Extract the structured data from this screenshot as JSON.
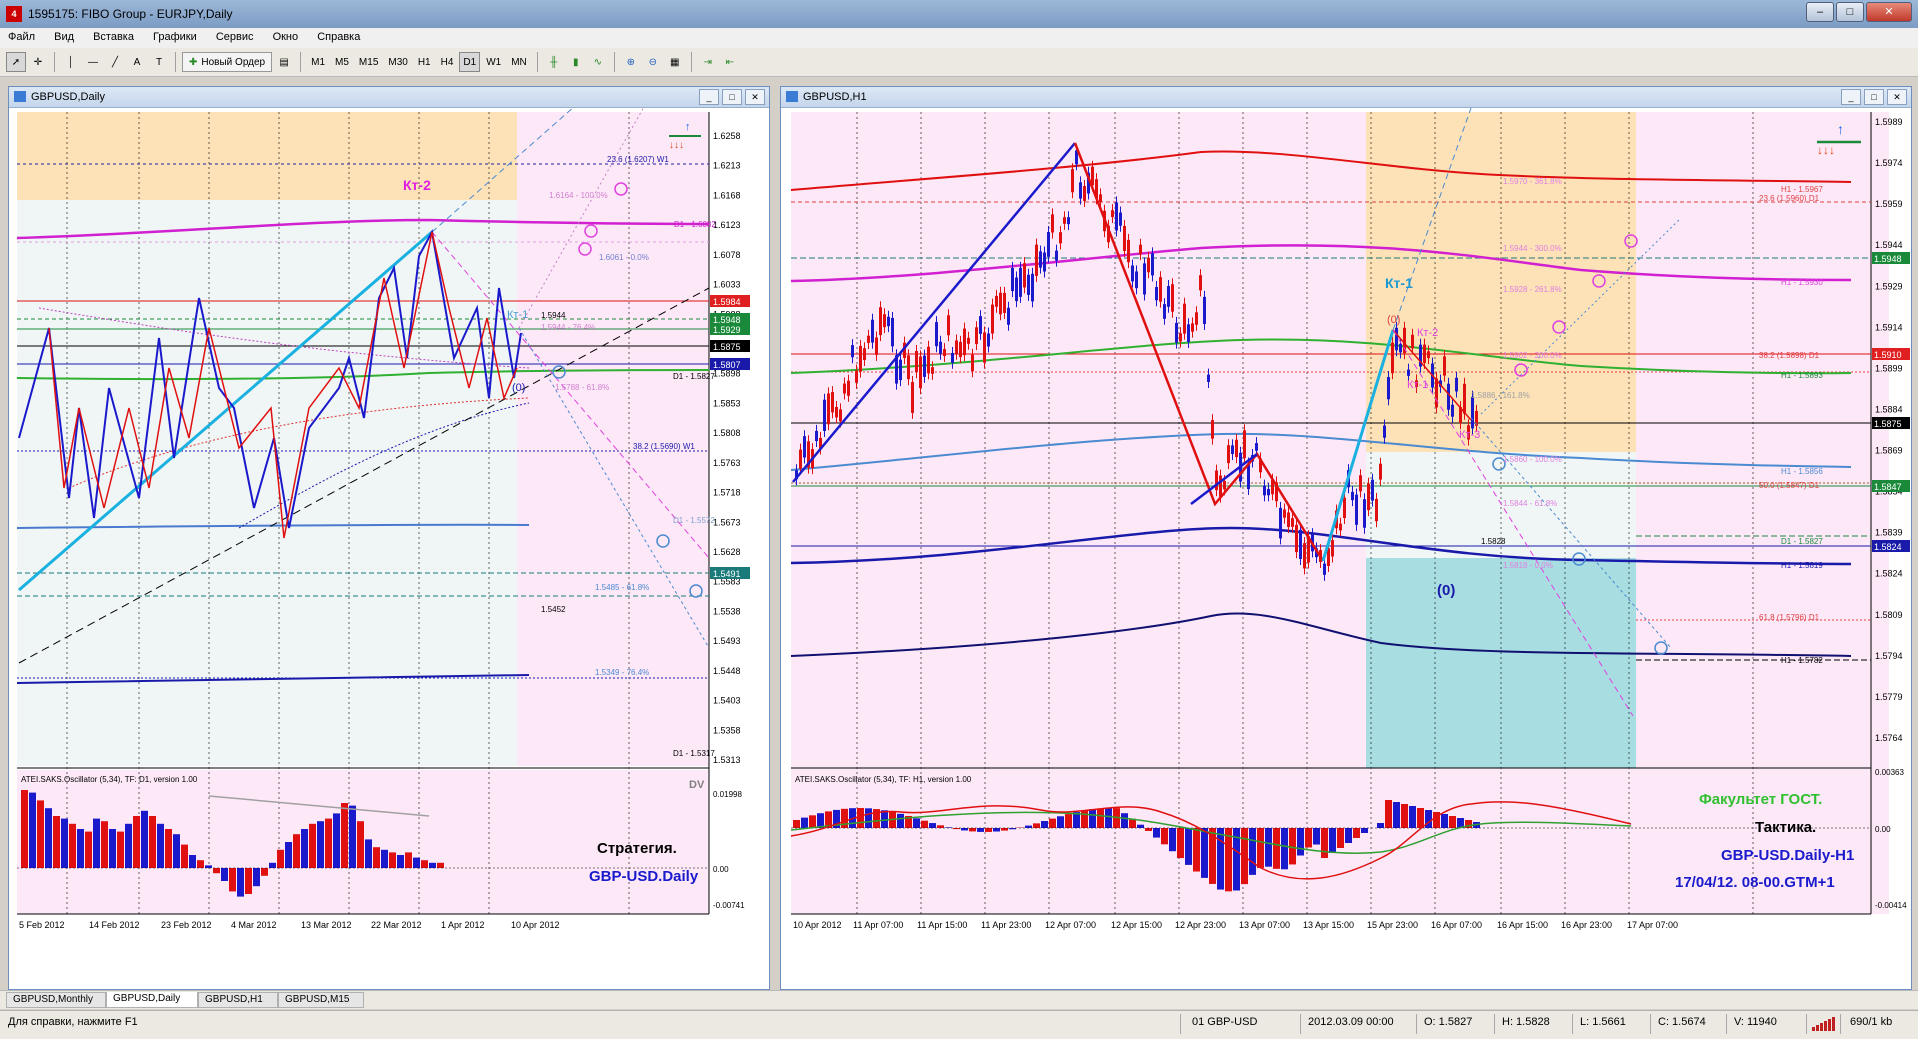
{
  "window": {
    "title": "1595175: FIBO Group - EURJPY,Daily",
    "minimize": "–",
    "maximize": "□",
    "close": "✕",
    "icon": "mt4-app-icon"
  },
  "menu": [
    "Файл",
    "Вид",
    "Вставка",
    "Графики",
    "Сервис",
    "Окно",
    "Справка"
  ],
  "toolbar": {
    "new_order": "Новый Ордер",
    "timeframes": [
      "M1",
      "M5",
      "M15",
      "M30",
      "H1",
      "H4",
      "D1",
      "W1",
      "MN"
    ],
    "active_timeframe": "D1",
    "tools": [
      "cursor-icon",
      "crosshair-icon",
      "vertical-line-icon",
      "horizontal-line-icon",
      "trendline-icon",
      "text-icon",
      "label-icon",
      "zoom-in-icon",
      "zoom-out-icon",
      "grid-icon",
      "autoscroll-icon",
      "chart-shift-icon"
    ]
  },
  "left_chart": {
    "title": "GBPUSD,Daily",
    "label_kt2": "Кт-2",
    "label_kt1": "Кт-1",
    "label_zero": "(0)",
    "price_axis": [
      "1.6258",
      "1.6213",
      "1.6168",
      "1.6123",
      "1.6078",
      "1.6033",
      "1.5988",
      "1.5943",
      "1.5898",
      "1.5853",
      "1.5808",
      "1.5763",
      "1.5718",
      "1.5673",
      "1.5628",
      "1.5583",
      "1.5538",
      "1.5493",
      "1.5448",
      "1.5403",
      "1.5358",
      "1.5313"
    ],
    "price_tags": [
      {
        "value": "1.5984",
        "color": "#e02020"
      },
      {
        "value": "1.5948",
        "color": "#1a8a3a"
      },
      {
        "value": "1.5929",
        "color": "#1a8a3a"
      },
      {
        "value": "1.5875",
        "color": "#000000"
      },
      {
        "value": "1.5807",
        "color": "#1a1aaa"
      },
      {
        "value": "1.5491",
        "color": "#1a7a7a"
      }
    ],
    "level_labels": [
      "23.6 (1.6207) W1",
      "1.6164 - 100.0%",
      "D1 - 1.6082",
      "1.6061 - 0.0%",
      "1.5944",
      "1.5944 - 76.4%",
      "D1 - 1.5827",
      "1.5788 - 61.8%",
      "38.2 (1.5690) W1",
      "D1 - 1.5572",
      "1.5485 - 61.8%",
      "1.5452",
      "1.5349 - 76.4%",
      "D1 - 1.5317"
    ],
    "date_axis": [
      "5 Feb 2012",
      "14 Feb 2012",
      "23 Feb 2012",
      "4 Mar 2012",
      "13 Mar 2012",
      "22 Mar 2012",
      "1 Apr 2012",
      "10 Apr 2012"
    ],
    "oscillator": {
      "title": "ATEI.SAKS.Oscillator (5,34), TF: D1, version 1.00",
      "dv": "DV",
      "axis": [
        "0.01998",
        "0.00",
        "-0.00741"
      ],
      "caption1": "Стратегия.",
      "caption2": "GBP-USD.Daily"
    }
  },
  "right_chart": {
    "title": "GBPUSD,H1",
    "label_kt1": "Кт-1",
    "label_kt2": "Кт-2",
    "label_kt1b": "Кт-1",
    "label_kt3": "Кт-3",
    "label_zero_top": "(0)",
    "label_zero_bottom": "(0)",
    "price_axis": [
      "1.5989",
      "1.5974",
      "1.5959",
      "1.5944",
      "1.5929",
      "1.5914",
      "1.5899",
      "1.5884",
      "1.5869",
      "1.5854",
      "1.5839",
      "1.5824",
      "1.5809",
      "1.5794",
      "1.5779",
      "1.5764"
    ],
    "price_tags": [
      {
        "value": "1.5948",
        "color": "#1a8a3a"
      },
      {
        "value": "1.5910",
        "color": "#e02020"
      },
      {
        "value": "1.5875",
        "color": "#000000"
      },
      {
        "value": "1.5847",
        "color": "#1a8a3a"
      },
      {
        "value": "1.5824",
        "color": "#1a1aaa"
      }
    ],
    "level_labels": [
      "1.5970 - 361.8%",
      "H1 - 1.5967",
      "23.6 (1.5960) D1",
      "1.5944 - 300.0%",
      "1.5928 - 261.8%",
      "H1 - 1.5930",
      "1.5902 - 200.0%",
      "38.2 (1.5898) D1",
      "H1 - 1.5893",
      "1.5886 - 161.8%",
      "1.5860 - 100.0%",
      "H1 - 1.5856",
      "50.0 (1.5847) D1",
      "1.5844 - 61.8%",
      "1.5828",
      "D1 - 1.5827",
      "1.5818 - 0.0%",
      "H1 - 1.5819",
      "61.8 (1.5796) D1",
      "H1 - 1.5782"
    ],
    "date_axis": [
      "10 Apr 2012",
      "11 Apr 07:00",
      "11 Apr 15:00",
      "11 Apr 23:00",
      "12 Apr 07:00",
      "12 Apr 15:00",
      "12 Apr 23:00",
      "13 Apr 07:00",
      "13 Apr 15:00",
      "15 Apr 23:00",
      "16 Apr 07:00",
      "16 Apr 15:00",
      "16 Apr 23:00",
      "17 Apr 07:00"
    ],
    "oscillator": {
      "title": "ATEI.SAKS.Oscillator (5,34), TF: H1, version 1.00",
      "axis": [
        "0.00363",
        "0.00",
        "-0.00414"
      ],
      "caption1": "Факультет ГОСТ.",
      "caption2": "Тактика.",
      "caption3": "GBP-USD.Daily-H1",
      "caption4": "17/04/12. 08-00.GTM+1"
    }
  },
  "tabs": [
    "GBPUSD,Monthly",
    "GBPUSD,Daily",
    "GBPUSD,H1",
    "GBPUSD,M15"
  ],
  "active_tab": "GBPUSD,Daily",
  "status": {
    "help": "Для справки, нажмите F1",
    "profile": "01 GBP-USD",
    "datetime": "2012.03.09 00:00",
    "open": "O: 1.5827",
    "high": "H: 1.5828",
    "low": "L: 1.5661",
    "close": "C: 1.5674",
    "volume": "V: 11940",
    "traffic": "690/1 kb"
  },
  "colors": {
    "bull_candle": "#1a1acc",
    "bear_candle": "#e01010",
    "oscillator_positive": "#e01010",
    "oscillator_negative": "#1a1acc",
    "zone_orange": "#fde2b8",
    "zone_pink": "#fde8f8",
    "zone_cyan": "#a8dde2"
  }
}
